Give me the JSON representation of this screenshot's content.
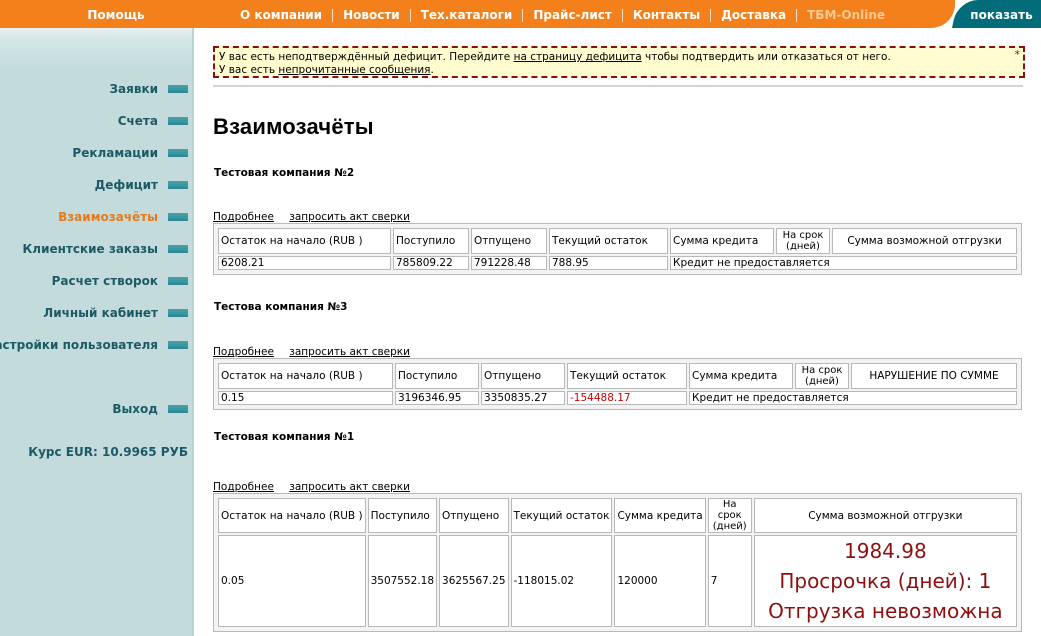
{
  "topnav": {
    "help": "Помощь",
    "items": [
      "О компании",
      "Новости",
      "Тех.каталоги",
      "Прайс-лист",
      "Контакты",
      "Доставка",
      "ТБМ-Online"
    ],
    "show_button": "показать"
  },
  "sidebar": {
    "items": [
      "Заявки",
      "Счета",
      "Рекламации",
      "Дефицит",
      "Взаимозачёты",
      "Клиентские заказы",
      "Расчет створок",
      "Личный кабинет",
      "Настройки пользователя"
    ],
    "active": "Взаимозачёты",
    "logout": "Выход",
    "rate": "Курс EUR: 10.9965 РУБ"
  },
  "notice": {
    "line1_prefix": "У вас есть неподтверждённый дефицит. Перейдите ",
    "line1_link": "на страницу дефицита",
    "line1_suffix": " чтобы подтвердить или отказаться от него.",
    "line2_prefix": "У вас есть ",
    "line2_link": "непрочитанные сообщения",
    "line2_suffix": ".",
    "close": "*"
  },
  "page_title": "Взаимозачёты",
  "links": {
    "details": "Подробнее",
    "request": "запросить акт сверки"
  },
  "headers": {
    "opening": "Остаток на начало (RUB )",
    "received": "Поступило",
    "shipped": "Отпущено",
    "current": "Текущий остаток",
    "credit": "Сумма кредита",
    "term": "На срок (дней)",
    "possible": "Сумма возможной отгрузки",
    "violation": "НАРУШЕНИЕ ПО СУММЕ"
  },
  "companies": [
    {
      "name": "Тестовая компания №2",
      "opening": "6208.21",
      "received": "785809.22",
      "shipped": "791228.48",
      "current": "788.95",
      "credit": "Кредит не предоставляется"
    },
    {
      "name": "Тестова компания №3",
      "opening": "0.15",
      "received": "3196346.95",
      "shipped": "3350835.27",
      "current": "-154488.17",
      "credit": "Кредит не предоставляется"
    },
    {
      "name": "Тестовая компания №1",
      "opening": "0.05",
      "received": "3507552.18",
      "shipped": "3625567.25",
      "current": "-118015.02",
      "credit": "120000",
      "term": "7",
      "possible_amount": "1984.98",
      "overdue": "Просрочка (дней): 1",
      "status": "Отгрузка невозможна"
    }
  ],
  "colors": {
    "orange": "#f3801a",
    "teal": "#036c7b",
    "accent_red": "#8c1010",
    "negative": "#cc0000",
    "sidebar_bg": "#c3dcdb"
  }
}
